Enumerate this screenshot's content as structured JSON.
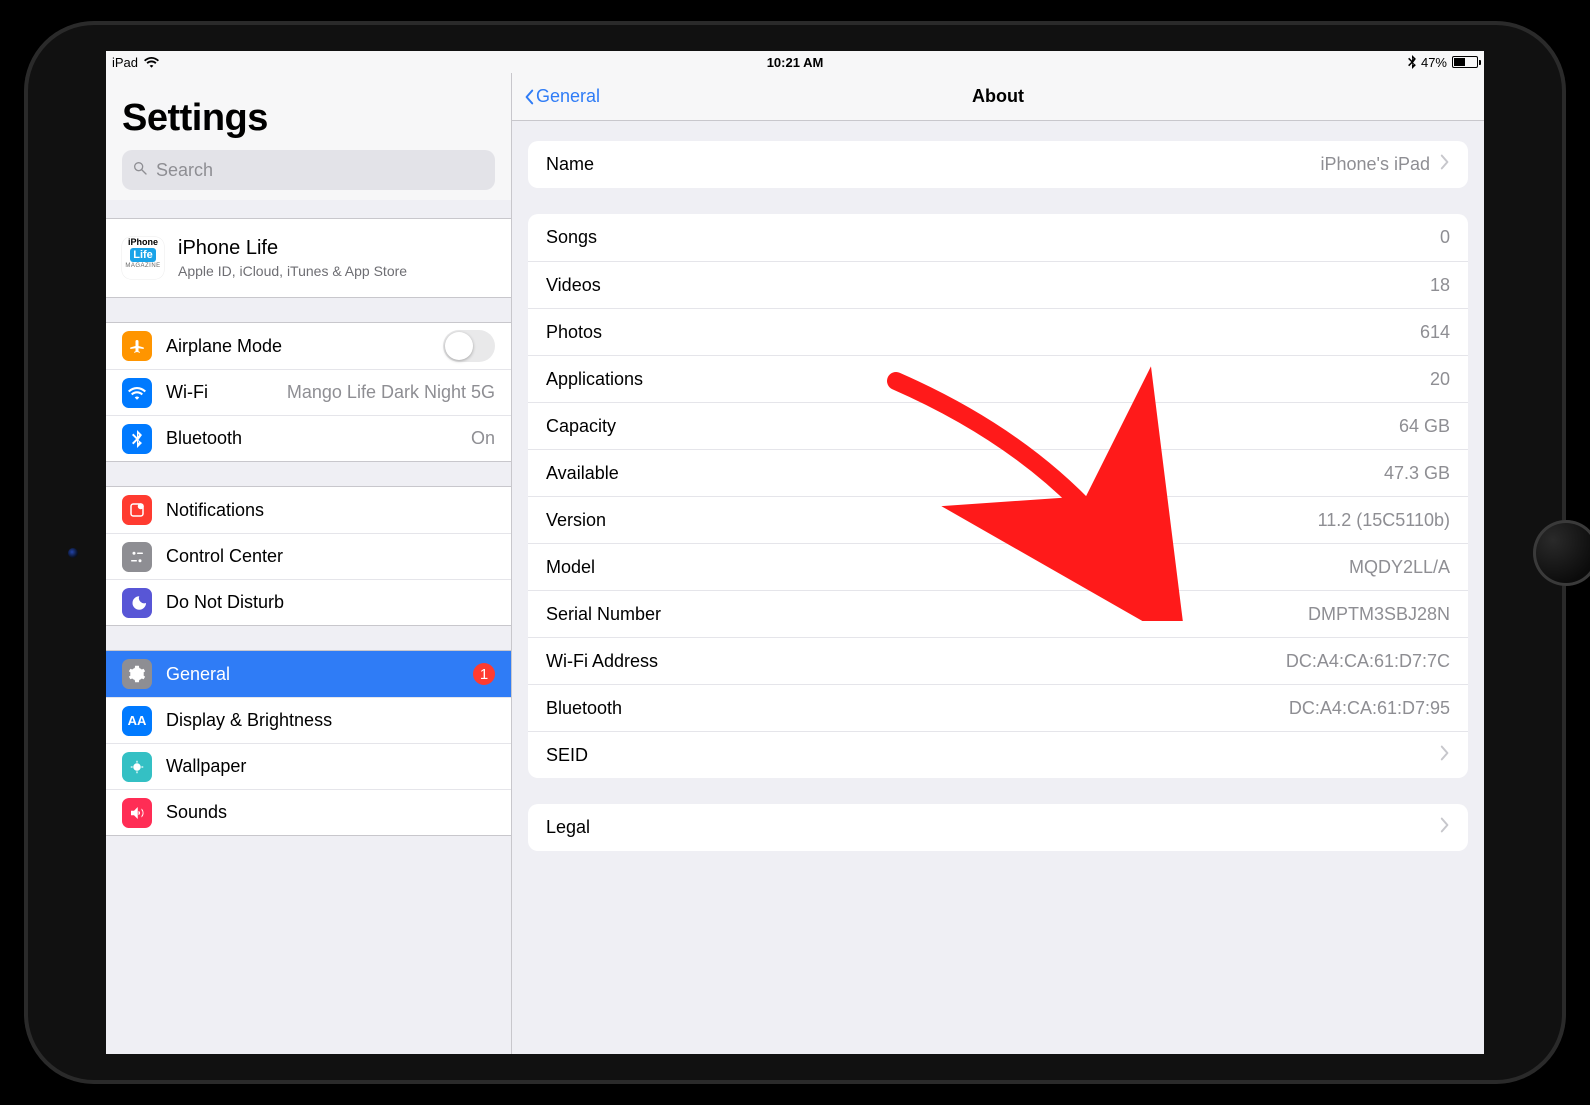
{
  "status": {
    "device": "iPad",
    "time": "10:21 AM",
    "battery_pct": "47%"
  },
  "sidebar": {
    "title": "Settings",
    "search_placeholder": "Search",
    "appleid": {
      "name": "iPhone Life",
      "subtitle": "Apple ID, iCloud, iTunes & App Store",
      "icon_top": "iPhone",
      "icon_mid": "Life",
      "icon_bot": "MAGAZINE"
    },
    "airplane": "Airplane Mode",
    "wifi_label": "Wi-Fi",
    "wifi_value": "Mango Life Dark Night 5G",
    "bluetooth_label": "Bluetooth",
    "bluetooth_value": "On",
    "notifications": "Notifications",
    "control_center": "Control Center",
    "dnd": "Do Not Disturb",
    "general": "General",
    "general_badge": "1",
    "display": "Display & Brightness",
    "wallpaper": "Wallpaper",
    "sounds": "Sounds"
  },
  "detail": {
    "back": "General",
    "title": "About",
    "name_label": "Name",
    "name_value": "iPhone's iPad",
    "rows": {
      "songs_l": "Songs",
      "songs_v": "0",
      "videos_l": "Videos",
      "videos_v": "18",
      "photos_l": "Photos",
      "photos_v": "614",
      "apps_l": "Applications",
      "apps_v": "20",
      "capacity_l": "Capacity",
      "capacity_v": "64 GB",
      "available_l": "Available",
      "available_v": "47.3 GB",
      "version_l": "Version",
      "version_v": "11.2 (15C5110b)",
      "model_l": "Model",
      "model_v": "MQDY2LL/A",
      "serial_l": "Serial Number",
      "serial_v": "DMPTM3SBJ28N",
      "wifiaddr_l": "Wi-Fi Address",
      "wifiaddr_v": "DC:A4:CA:61:D7:7C",
      "btaddr_l": "Bluetooth",
      "btaddr_v": "DC:A4:CA:61:D7:95",
      "seid_l": "SEID"
    },
    "legal": "Legal"
  }
}
